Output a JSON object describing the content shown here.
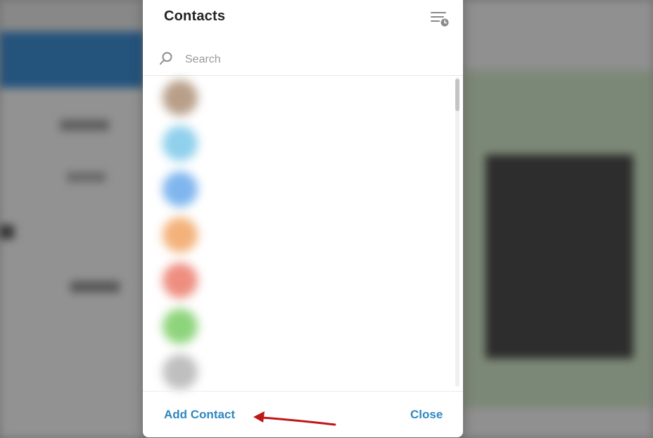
{
  "dialog": {
    "title": "Contacts",
    "sort_icon": "sort-by-time-icon"
  },
  "search": {
    "placeholder": "Search",
    "value": "",
    "icon": "search-icon"
  },
  "contacts": [
    {
      "name": "",
      "status": "",
      "avatar_color": "#b89f8a"
    },
    {
      "name": "",
      "status": "",
      "avatar_color": "#8fd0ec"
    },
    {
      "name": "",
      "status": "",
      "avatar_color": "#7fb6ee"
    },
    {
      "name": "",
      "status": "",
      "avatar_color": "#f3b27a"
    },
    {
      "name": "",
      "status": "",
      "avatar_color": "#ee8e80"
    },
    {
      "name": "",
      "status": "",
      "avatar_color": "#8ed47c"
    },
    {
      "name": "",
      "status": "",
      "avatar_color": "#bfbfbf"
    }
  ],
  "footer": {
    "add_label": "Add Contact",
    "close_label": "Close"
  },
  "colors": {
    "accent": "#2f87c0",
    "annotation_arrow": "#c0161a",
    "overlay": "rgba(0,0,0,0.38)"
  }
}
